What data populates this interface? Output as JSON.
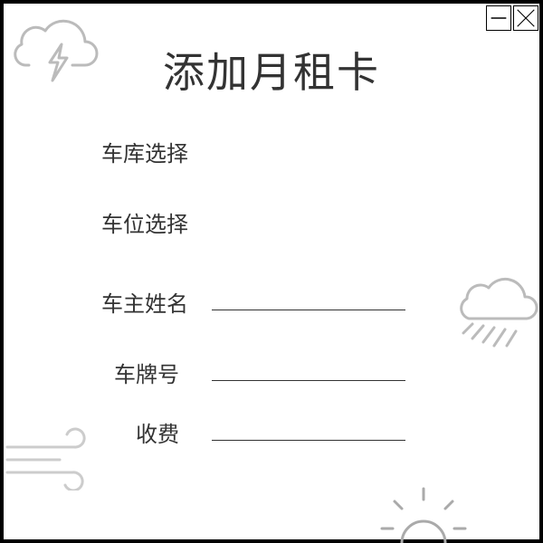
{
  "window": {
    "minimize_icon": "minimize-icon",
    "close_icon": "close-icon"
  },
  "title": "添加月租卡",
  "form": {
    "garage_label": "车库选择",
    "space_label": "车位选择",
    "owner_name_label": "车主姓名",
    "plate_label": "车牌号",
    "fee_label": "收费",
    "owner_name_value": "",
    "plate_value": "",
    "fee_value": ""
  },
  "decorations": [
    "thunder-cloud-icon",
    "rain-cloud-icon",
    "wind-icon",
    "sun-icon"
  ],
  "colors": {
    "border": "#000000",
    "icon_gray": "#bbbbbb",
    "text": "#333333"
  }
}
